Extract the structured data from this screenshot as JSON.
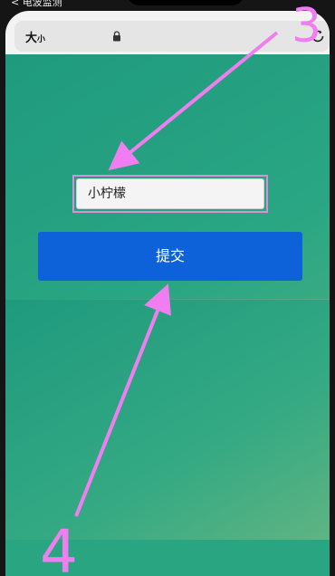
{
  "status_bar": {
    "text": "< 电波监测"
  },
  "browser": {
    "text_size_big": "大",
    "text_size_small": "小",
    "lock_icon": "lock-icon",
    "refresh_icon": "refresh-icon"
  },
  "form": {
    "name_value": "小柠檬",
    "submit_label": "提交"
  },
  "annotations": {
    "label_top": "3",
    "label_bottom": "4",
    "color": "#f07ef0"
  }
}
